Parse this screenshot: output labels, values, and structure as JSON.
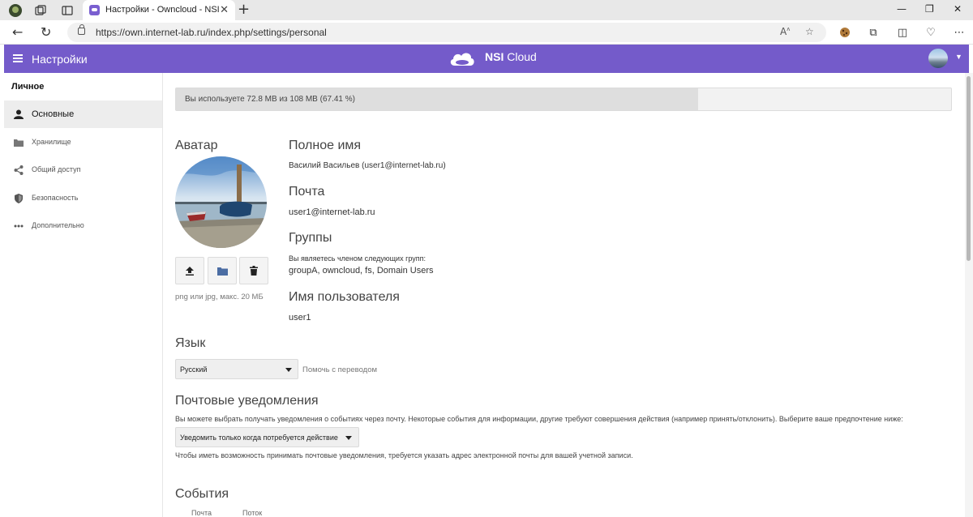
{
  "browser": {
    "tab_title": "Настройки - Owncloud - NSI",
    "tab_close": "✕",
    "new_tab": "+",
    "url": "https://own.internet-lab.ru/index.php/settings/personal",
    "window_controls": [
      "—",
      "❐",
      "✕"
    ]
  },
  "header": {
    "menu_icon": "hamburger-icon",
    "title": "Настройки",
    "brand_bold": "NSI",
    "brand_rest": " Cloud"
  },
  "sidebar": {
    "heading": "Личное",
    "items": [
      {
        "label": "Основные",
        "icon": "user-icon",
        "active": true
      },
      {
        "label": "Хранилище",
        "icon": "folder-icon",
        "active": false
      },
      {
        "label": "Общий доступ",
        "icon": "share-icon",
        "active": false
      },
      {
        "label": "Безопасность",
        "icon": "shield-icon",
        "active": false
      },
      {
        "label": "Дополнительно",
        "icon": "more-icon",
        "active": false
      }
    ]
  },
  "quota": {
    "text": "Вы используете 72.8 MB из 108 MB (67.41 %)",
    "used_fraction": 0.6741
  },
  "avatar": {
    "heading": "Аватар",
    "hint": "png или jpg, макс. 20 МБ"
  },
  "profile": {
    "fullname_heading": "Полное имя",
    "fullname": "Василий Васильев (user1@internet-lab.ru)",
    "email_heading": "Почта",
    "email": "user1@internet-lab.ru",
    "groups_heading": "Группы",
    "groups_intro": "Вы являетесь членом следующих групп:",
    "groups": "groupA, owncloud, fs, Domain Users",
    "username_heading": "Имя пользователя",
    "username": "user1"
  },
  "language": {
    "heading": "Язык",
    "selected": "Русский",
    "help_link": "Помочь с переводом"
  },
  "notifications": {
    "heading": "Почтовые уведомления",
    "description": "Вы можете выбрать получать уведомления о событиях через почту. Некоторые события для информации, другие требуют совершения действия (например принять/отклонить). Выберите ваше предпочтение ниже:",
    "selected": "Уведомить только когда потребуется действие",
    "footnote": "Чтобы иметь возможность принимать почтовые уведомления, требуется указать адрес электронной почты для вашей учетной записи."
  },
  "events": {
    "heading": "События",
    "col_mail": "Почта",
    "col_stream": "Поток"
  },
  "colors": {
    "header_bg": "#745bca"
  }
}
